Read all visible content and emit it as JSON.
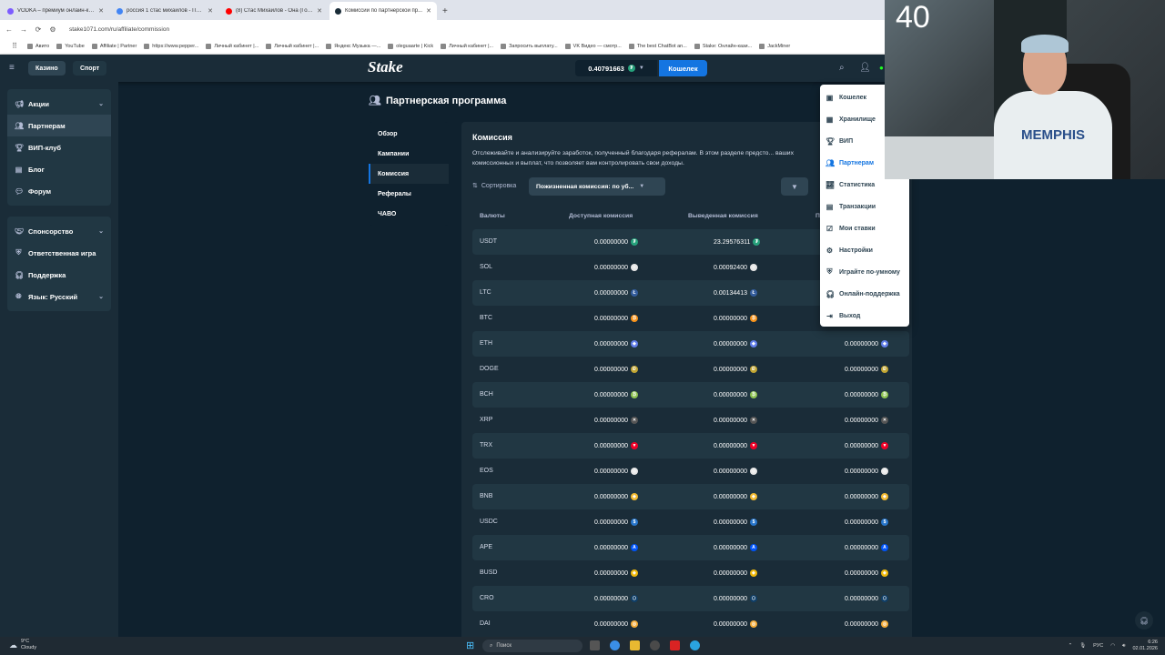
{
  "browser": {
    "tabs": [
      {
        "title": "VODKA – премиум онлайн-ка...",
        "active": false,
        "color": "#7d5cff"
      },
      {
        "title": "россия 1 стас михайлов - Пои...",
        "active": false,
        "color": "#4285f4"
      },
      {
        "title": "(8) Стас Михайлов - Она (Гол...",
        "active": false,
        "color": "#ff0000"
      },
      {
        "title": "Комиссии по партнерской пр...",
        "active": true,
        "color": "#1a2c38"
      }
    ],
    "url": "stake1071.com/ru/affiliate/commission",
    "bookmarks": [
      "Авито",
      "YouTube",
      "Affiliate | Partner",
      "https://www.pepper...",
      "Личный кабинет |...",
      "Личный кабинет |...",
      "Яндекс Музыка —...",
      "oleguaarte | Kick",
      "Личный кабинет |...",
      "Запросить выплату...",
      "VK Видео — смотр...",
      "The best ChatBot an...",
      "Stake: Онлайн-кази...",
      "JackMiner"
    ]
  },
  "header": {
    "casino_label": "Казино",
    "sport_label": "Спорт",
    "logo": "Stake",
    "balance": "0.40791663",
    "wallet_label": "Кошелек"
  },
  "sidebar": {
    "group1": [
      {
        "label": "Акции",
        "icon": "megaphone-icon",
        "chevron": true
      },
      {
        "label": "Партнерам",
        "icon": "partners-icon",
        "active": true
      },
      {
        "label": "ВИП-клуб",
        "icon": "trophy-icon"
      },
      {
        "label": "Блог",
        "icon": "blog-icon"
      },
      {
        "label": "Форум",
        "icon": "forum-icon"
      }
    ],
    "group2": [
      {
        "label": "Спонсорство",
        "icon": "sponsor-icon",
        "chevron": true
      },
      {
        "label": "Ответственная игра",
        "icon": "shield-icon"
      },
      {
        "label": "Поддержка",
        "icon": "headset-icon"
      },
      {
        "label": "Язык: Русский",
        "icon": "globe-icon",
        "chevron": true
      }
    ]
  },
  "page": {
    "title": "Партнерская программа",
    "subnav": [
      {
        "label": "Обзор"
      },
      {
        "label": "Кампании"
      },
      {
        "label": "Комиссия",
        "active": true
      },
      {
        "label": "Рефералы"
      },
      {
        "label": "ЧАВО"
      }
    ],
    "panel_title": "Комиссия",
    "description": "Отслеживайте и анализируйте заработок, полученный благодаря рефералам. В этом разделе предсто... ваших комиссионных и выплат, что позволяет вам контролировать свои доходы.",
    "sort_label": "Сортировка",
    "sort_value": "Пожизненная комиссия: по уб...",
    "columns": [
      "Валюты",
      "Доступная комиссия",
      "Выведенная комиссия",
      "П"
    ],
    "rows": [
      {
        "currency": "USDT",
        "available": "0.00000000",
        "withdrawn": "23.29576311",
        "lifetime": "",
        "coin_color": "#26a17b",
        "coin_glyph": "₮"
      },
      {
        "currency": "SOL",
        "available": "0.00000000",
        "withdrawn": "0.00092400",
        "lifetime": "",
        "coin_color": "#e8e8e8",
        "coin_glyph": "≡"
      },
      {
        "currency": "LTC",
        "available": "0.00000000",
        "withdrawn": "0.00134413",
        "lifetime": "",
        "coin_color": "#345d9d",
        "coin_glyph": "Ł"
      },
      {
        "currency": "BTC",
        "available": "0.00000000",
        "withdrawn": "0.00000000",
        "lifetime": "",
        "coin_color": "#f7931a",
        "coin_glyph": "₿"
      },
      {
        "currency": "ETH",
        "available": "0.00000000",
        "withdrawn": "0.00000000",
        "lifetime": "0.00000000",
        "coin_color": "#627eea",
        "coin_glyph": "◆"
      },
      {
        "currency": "DOGE",
        "available": "0.00000000",
        "withdrawn": "0.00000000",
        "lifetime": "0.00000000",
        "coin_color": "#c2a633",
        "coin_glyph": "Ð"
      },
      {
        "currency": "BCH",
        "available": "0.00000000",
        "withdrawn": "0.00000000",
        "lifetime": "0.00000000",
        "coin_color": "#8dc351",
        "coin_glyph": "₿"
      },
      {
        "currency": "XRP",
        "available": "0.00000000",
        "withdrawn": "0.00000000",
        "lifetime": "0.00000000",
        "coin_color": "#555",
        "coin_glyph": "✕"
      },
      {
        "currency": "TRX",
        "available": "0.00000000",
        "withdrawn": "0.00000000",
        "lifetime": "0.00000000",
        "coin_color": "#ef0027",
        "coin_glyph": "▼"
      },
      {
        "currency": "EOS",
        "available": "0.00000000",
        "withdrawn": "0.00000000",
        "lifetime": "0.00000000",
        "coin_color": "#e8e8e8",
        "coin_glyph": "◇"
      },
      {
        "currency": "BNB",
        "available": "0.00000000",
        "withdrawn": "0.00000000",
        "lifetime": "0.00000000",
        "coin_color": "#f3ba2f",
        "coin_glyph": "◈"
      },
      {
        "currency": "USDC",
        "available": "0.00000000",
        "withdrawn": "0.00000000",
        "lifetime": "0.00000000",
        "coin_color": "#2775ca",
        "coin_glyph": "$"
      },
      {
        "currency": "APE",
        "available": "0.00000000",
        "withdrawn": "0.00000000",
        "lifetime": "0.00000000",
        "coin_color": "#0054f9",
        "coin_glyph": "A"
      },
      {
        "currency": "BUSD",
        "available": "0.00000000",
        "withdrawn": "0.00000000",
        "lifetime": "0.00000000",
        "coin_color": "#f0b90b",
        "coin_glyph": "◈"
      },
      {
        "currency": "CRO",
        "available": "0.00000000",
        "withdrawn": "0.00000000",
        "lifetime": "0.00000000",
        "coin_color": "#103f68",
        "coin_glyph": "⬡"
      },
      {
        "currency": "DAI",
        "available": "0.00000000",
        "withdrawn": "0.00000000",
        "lifetime": "0.00000000",
        "coin_color": "#f5ac37",
        "coin_glyph": "◎"
      }
    ]
  },
  "user_menu": [
    {
      "label": "Кошелек",
      "icon": "wallet-icon"
    },
    {
      "label": "Хранилище",
      "icon": "vault-icon"
    },
    {
      "label": "ВИП",
      "icon": "trophy-icon"
    },
    {
      "label": "Партнерам",
      "icon": "partners-icon",
      "active": true
    },
    {
      "label": "Статистика",
      "icon": "chart-icon"
    },
    {
      "label": "Транзакции",
      "icon": "transactions-icon"
    },
    {
      "label": "Мои ставки",
      "icon": "bets-icon"
    },
    {
      "label": "Настройки",
      "icon": "gear-icon"
    },
    {
      "label": "Играйте по-умному",
      "icon": "shield-icon"
    },
    {
      "label": "Онлайн-поддержка",
      "icon": "headset-icon"
    },
    {
      "label": "Выход",
      "icon": "logout-icon"
    }
  ],
  "webcam": {
    "counter": "40",
    "jersey_text": "MEMPHIS"
  },
  "taskbar": {
    "weather_temp": "9°C",
    "weather_desc": "Cloudy",
    "search_placeholder": "Поиск",
    "lang": "РУС",
    "time": "6:26",
    "date": "02.01.2026"
  }
}
